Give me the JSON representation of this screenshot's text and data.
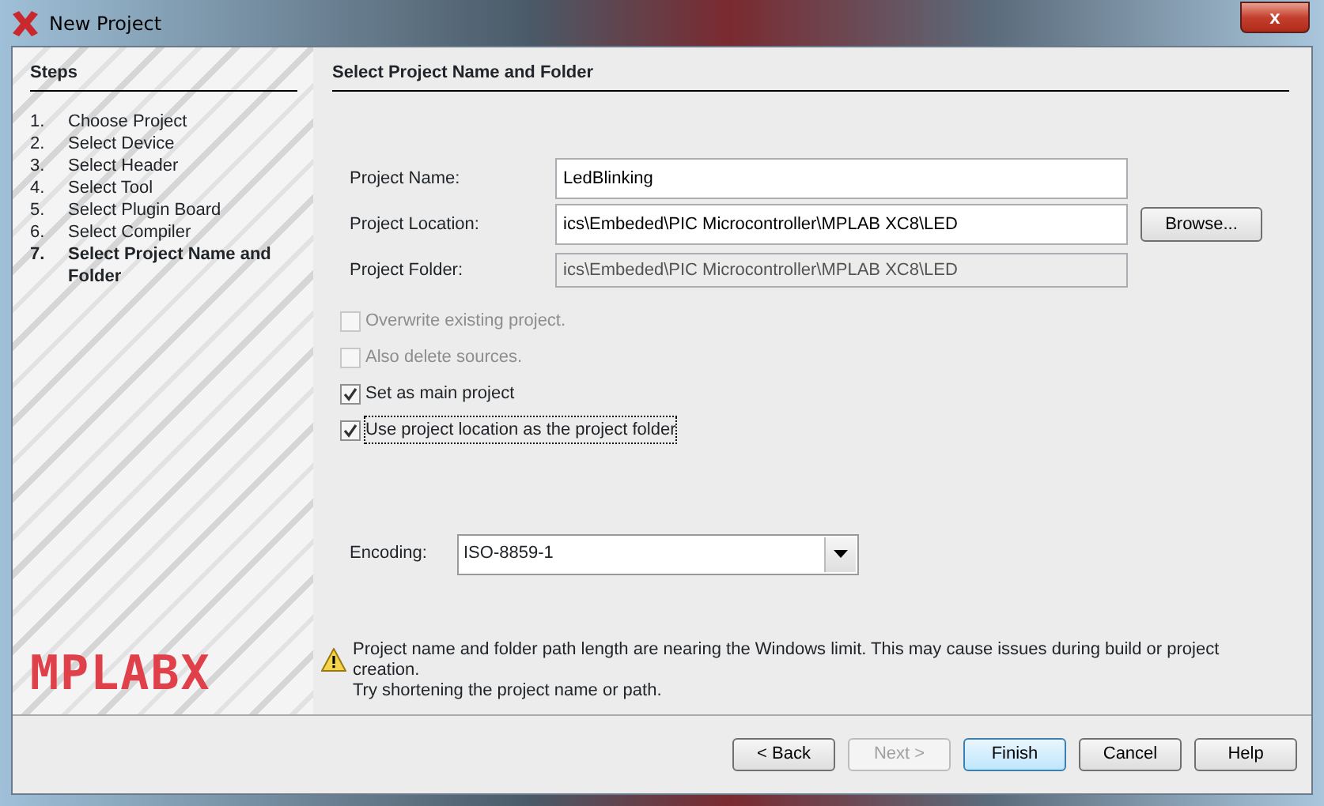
{
  "window": {
    "title": "New Project",
    "close_label": "x"
  },
  "steps": {
    "title": "Steps",
    "items": [
      {
        "number": "1.",
        "label": "Choose Project",
        "selected": false
      },
      {
        "number": "2.",
        "label": "Select Device",
        "selected": false
      },
      {
        "number": "3.",
        "label": "Select Header",
        "selected": false
      },
      {
        "number": "4.",
        "label": "Select Tool",
        "selected": false
      },
      {
        "number": "5.",
        "label": "Select Plugin Board",
        "selected": false
      },
      {
        "number": "6.",
        "label": "Select Compiler",
        "selected": false
      },
      {
        "number": "7.",
        "label": "Select Project Name and Folder",
        "selected": true
      }
    ],
    "logo": "MPLABX"
  },
  "panel": {
    "title": "Select Project Name and Folder",
    "fields": [
      {
        "label": "Project Name:",
        "value": "LedBlinking",
        "disabled": false
      },
      {
        "label": "Project Location:",
        "value": "ics\\Embeded\\PIC Microcontroller\\MPLAB XC8\\LED",
        "disabled": false,
        "button": "Browse..."
      },
      {
        "label": "Project Folder:",
        "value": "ics\\Embeded\\PIC Microcontroller\\MPLAB XC8\\LED",
        "disabled": true
      }
    ],
    "checkboxes": [
      {
        "label": "Overwrite existing project.",
        "checked": false,
        "disabled": true,
        "focused": false
      },
      {
        "label": "Also delete sources.",
        "checked": false,
        "disabled": true,
        "focused": false
      },
      {
        "label": "Set as main project",
        "checked": true,
        "disabled": false,
        "focused": false
      },
      {
        "label": "Use project location as the project folder",
        "checked": true,
        "disabled": false,
        "focused": true
      }
    ],
    "encoding": {
      "label": "Encoding:",
      "value": "ISO-8859-1"
    },
    "warning": [
      "Project name and folder path length are nearing the Windows limit. This may cause issues during build or project creation.",
      "Try shortening the project name or path."
    ]
  },
  "buttons": [
    {
      "label": "< Back",
      "disabled": false,
      "default": false
    },
    {
      "label": "Next >",
      "disabled": true,
      "default": false
    },
    {
      "label": "Finish",
      "disabled": false,
      "default": true
    },
    {
      "label": "Cancel",
      "disabled": false,
      "default": false
    },
    {
      "label": "Help",
      "disabled": false,
      "default": false
    }
  ]
}
